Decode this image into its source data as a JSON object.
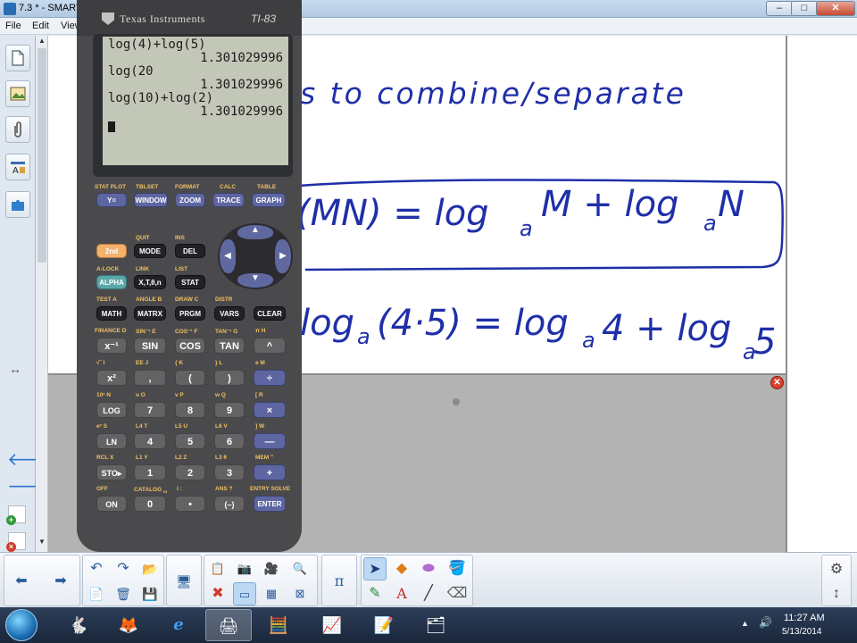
{
  "window": {
    "title": "7.3 * - SMART",
    "minimize": "–",
    "maximize": "□",
    "close": "✕"
  },
  "menu": [
    "File",
    "Edit",
    "View"
  ],
  "sidebar": {
    "tabs": [
      "page-sorter",
      "gallery",
      "attachments",
      "properties",
      "addons"
    ],
    "resize_glyph": "↔",
    "scroll_up": "▲",
    "scroll_down": "▼"
  },
  "board": {
    "line1": "s to combine/separate",
    "rule_left": "(MN) = log",
    "rule_sub1": "a",
    "rule_mid": " M + log",
    "rule_sub2": "a",
    "rule_right": " N",
    "ex_log1": "log",
    "ex_sub1": "a",
    "ex_arg": "(4·5) = log",
    "ex_sub2": "a",
    "ex_mid": " 4 + log",
    "ex_sub3": "a",
    "ex_end": " 5",
    "close_page": "✕",
    "ink_color": "#1f2fa8"
  },
  "calculator": {
    "brand": "Texas Instruments",
    "model": "TI-83",
    "screen": [
      {
        "text": "log(4)+log(5)",
        "align": "left"
      },
      {
        "text": "1.301029996",
        "align": "right"
      },
      {
        "text": "log(20",
        "align": "left"
      },
      {
        "text": "1.301029996",
        "align": "right"
      },
      {
        "text": "log(10)+log(2)",
        "align": "left"
      },
      {
        "text": "1.301029996",
        "align": "right"
      }
    ],
    "func_labels": [
      "STAT PLOT",
      "TBLSET",
      "FORMAT",
      "CALC",
      "TABLE"
    ],
    "func_keys": [
      "Y=",
      "WINDOW",
      "ZOOM",
      "TRACE",
      "GRAPH"
    ],
    "row1_labels": [
      "QUIT",
      "INS"
    ],
    "row1_keys": [
      "2nd",
      "MODE",
      "DEL"
    ],
    "row2_labels": [
      "A-LOCK",
      "LINK",
      "LIST"
    ],
    "row2_keys": [
      "ALPHA",
      "X,T,θ,n",
      "STAT"
    ],
    "row3_labels": [
      "TEST  A",
      "ANGLE  B",
      "DRAW  C",
      "DISTR"
    ],
    "row3_keys": [
      "MATH",
      "MATRX",
      "PRGM",
      "VARS",
      "CLEAR"
    ],
    "row4_labels": [
      "FINANCE D",
      "SIN⁻¹  E",
      "COS⁻¹  F",
      "TAN⁻¹  G",
      "π  H"
    ],
    "row4_keys": [
      "x⁻¹",
      "SIN",
      "COS",
      "TAN",
      "^"
    ],
    "row5_labels": [
      "√‾  I",
      "EE  J",
      "{  K",
      "}  L",
      "e  M"
    ],
    "row5_keys": [
      "x²",
      ",",
      "(",
      ")",
      "÷"
    ],
    "row6_labels": [
      "10ˣ  N",
      "u  O",
      "v  P",
      "w  Q",
      "[  R"
    ],
    "row6_keys": [
      "LOG",
      "7",
      "8",
      "9",
      "×"
    ],
    "row7_labels": [
      "eˣ  S",
      "L4  T",
      "L5  U",
      "L6  V",
      "]  W"
    ],
    "row7_keys": [
      "LN",
      "4",
      "5",
      "6",
      "—"
    ],
    "row8_labels": [
      "RCL  X",
      "L1  Y",
      "L2  Z",
      "L3  θ",
      "MEM  \""
    ],
    "row8_keys": [
      "STO▸",
      "1",
      "2",
      "3",
      "+"
    ],
    "row9_labels": [
      "OFF",
      "CATALOG  ␣",
      "i  :",
      "ANS  ?",
      "ENTRY SOLVE"
    ],
    "row9_keys": [
      "ON",
      "0",
      "•",
      "(–)",
      "ENTER"
    ],
    "dpad": {
      "up": "▲",
      "down": "▼",
      "left": "◀",
      "right": "▶"
    }
  },
  "toolbar": {
    "back": "⬅",
    "forward": "➡",
    "undo": "↶",
    "redo": "↷",
    "pi": "π",
    "settings": "⚙",
    "move": "↕"
  },
  "taskbar": {
    "time": "11:27 AM",
    "date": "5/13/2014",
    "tray_arrow": "▲",
    "speaker": "🔊"
  }
}
